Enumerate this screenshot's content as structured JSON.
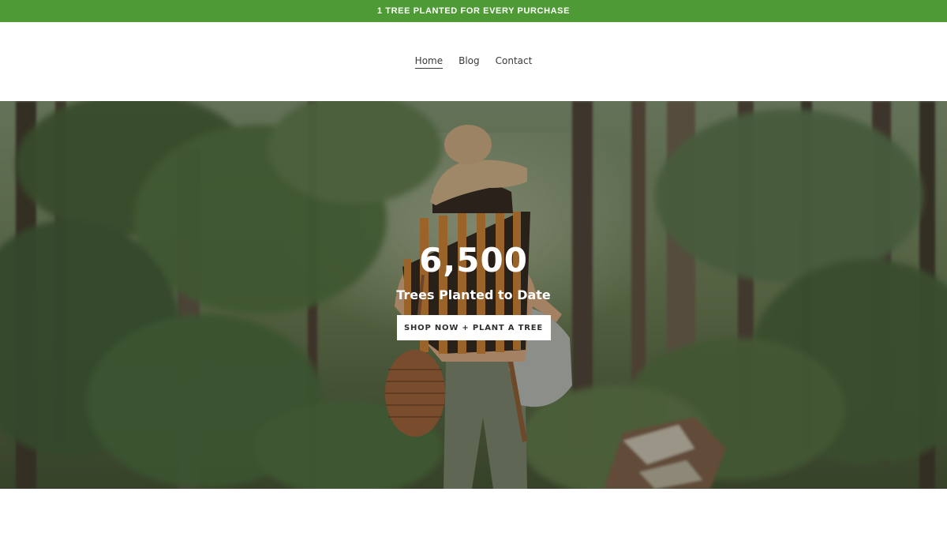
{
  "announcement": {
    "text": "1 TREE PLANTED FOR EVERY PURCHASE",
    "bg_color": "#4e9a35"
  },
  "nav": {
    "items": [
      {
        "label": "Home",
        "active": true
      },
      {
        "label": "Blog",
        "active": false
      },
      {
        "label": "Contact",
        "active": false
      }
    ]
  },
  "hero": {
    "count": "6,500",
    "subtitle": "Trees Planted to Date",
    "cta_label": "SHOP NOW + PLANT A TREE",
    "image": "forest-hiker-photo"
  }
}
